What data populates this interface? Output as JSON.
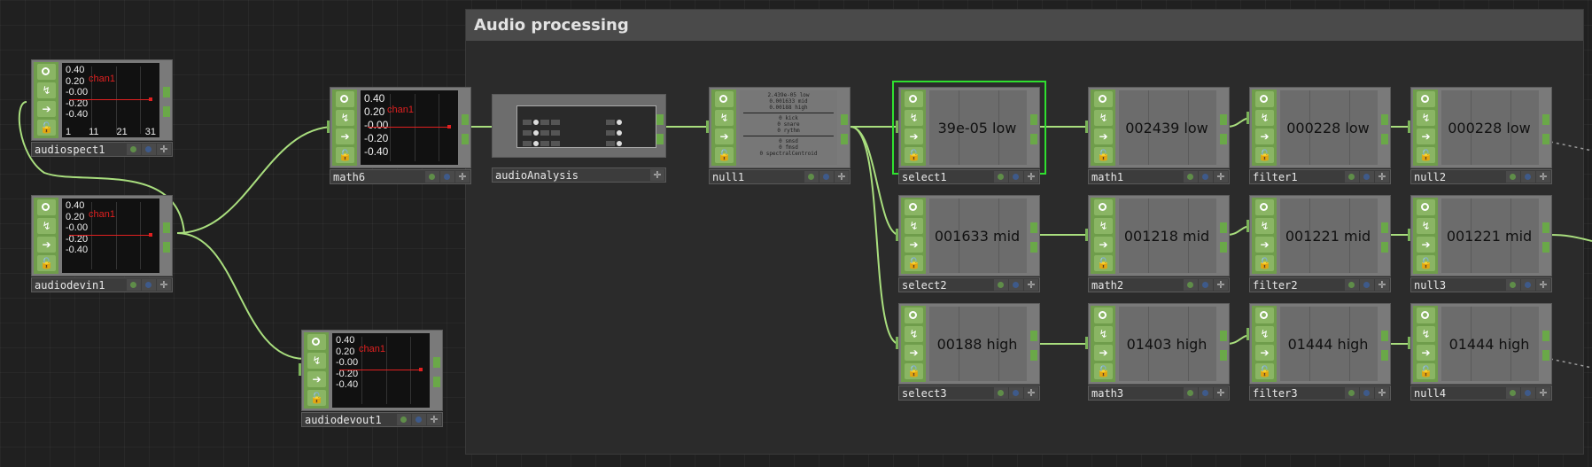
{
  "annotation": {
    "title": "Audio processing"
  },
  "nodes": {
    "audiospect1": {
      "label": "audiospect1",
      "y_ticks": [
        "0.40",
        "0.20",
        "-0.00",
        "-0.20",
        "-0.40"
      ],
      "channel": "chan1",
      "x_ticks": [
        "1",
        "11",
        "21",
        "31"
      ]
    },
    "audiodevin1": {
      "label": "audiodevin1",
      "y_ticks": [
        "0.40",
        "0.20",
        "-0.00",
        "-0.20",
        "-0.40"
      ],
      "channel": "chan1"
    },
    "audiodevout1": {
      "label": "audiodevout1",
      "y_ticks": [
        "0.40",
        "0.20",
        "-0.00",
        "-0.20",
        "-0.40"
      ],
      "channel": "chan1"
    },
    "math6": {
      "label": "math6",
      "y_ticks": [
        "0.40",
        "0.20",
        "-0.00",
        "-0.20",
        "-0.40"
      ],
      "channel": "chan1"
    },
    "audioAnalysis": {
      "label": "audioAnalysis"
    },
    "null1": {
      "label": "null1",
      "lines_top": [
        "2.439e-05 low",
        "0.001633 mid",
        "0.00188 high"
      ],
      "lines_mid": [
        "0 kick",
        "0 snare",
        "0 rythm"
      ],
      "lines_bot": [
        "0 smsd",
        "0 fmsd",
        "0 spectralCentroid"
      ]
    },
    "select1": {
      "label": "select1",
      "value": "39e-05 low"
    },
    "select2": {
      "label": "select2",
      "value": "001633 mid"
    },
    "select3": {
      "label": "select3",
      "value": "00188 high"
    },
    "math1": {
      "label": "math1",
      "value": "002439 low"
    },
    "math2": {
      "label": "math2",
      "value": "001218 mid"
    },
    "math3": {
      "label": "math3",
      "value": "01403 high"
    },
    "filter1": {
      "label": "filter1",
      "value": "000228 low"
    },
    "filter2": {
      "label": "filter2",
      "value": "001221 mid"
    },
    "filter3": {
      "label": "filter3",
      "value": "01444 high"
    },
    "null2": {
      "label": "null2",
      "value": "000228 low"
    },
    "null3": {
      "label": "null3",
      "value": "001221 mid"
    },
    "null4": {
      "label": "null4",
      "value": "01444 high"
    }
  },
  "colors": {
    "wire": "#a9de7e",
    "selection": "#2fe02f",
    "chop_strip": "#6f9d4b",
    "channel": "#e02020"
  }
}
